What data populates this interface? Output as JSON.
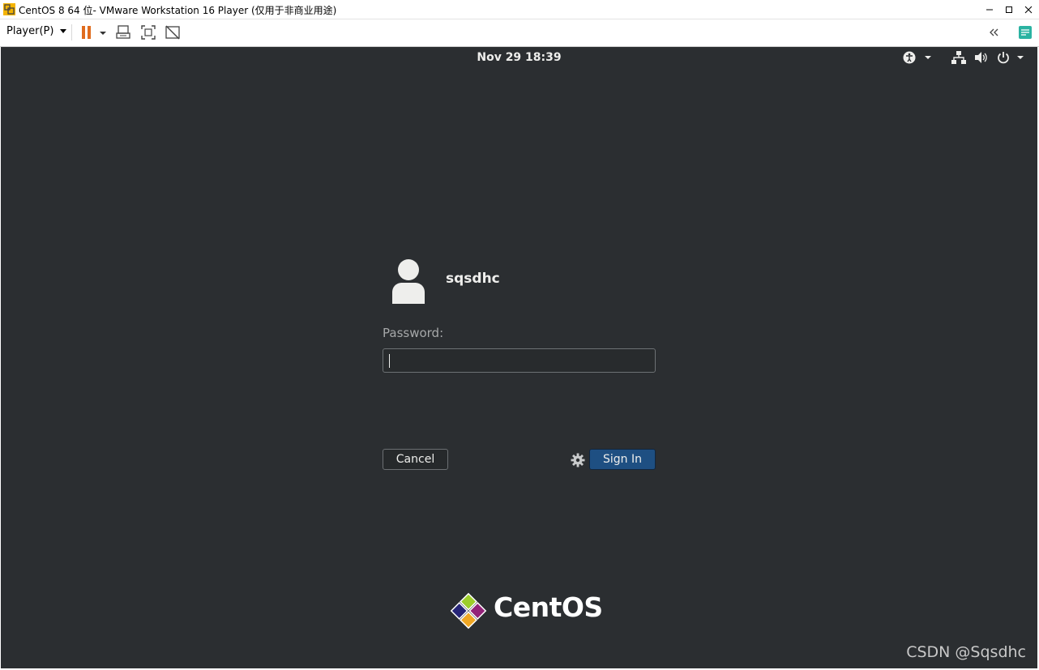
{
  "window": {
    "title": "CentOS 8 64 位- VMware Workstation 16 Player (仅用于非商业用途)"
  },
  "toolbar": {
    "player_menu": "Player(P)"
  },
  "gnome": {
    "clock": "Nov 29  18:39"
  },
  "login": {
    "username": "sqsdhc",
    "password_label": "Password:",
    "password_value": "",
    "cancel_label": "Cancel",
    "signin_label": "Sign In"
  },
  "branding": {
    "os_name": "CentOS"
  },
  "watermark": {
    "text": "CSDN @Sqsdhc"
  },
  "colors": {
    "background": "#2b2e31",
    "signin_button": "#1e4f82",
    "pause_icon": "#e06c1e",
    "text": "#eeeeec"
  },
  "icons": [
    "vmware-app-icon",
    "minimize-icon",
    "maximize-icon",
    "close-icon",
    "pause-icon",
    "dropdown-icon",
    "send-ctrl-alt-del-icon",
    "fullscreen-icon",
    "unity-icon",
    "collapse-icon",
    "notes-icon",
    "accessibility-icon",
    "network-icon",
    "volume-icon",
    "power-icon",
    "user-avatar-icon",
    "settings-gear-icon",
    "centos-logo-icon"
  ]
}
